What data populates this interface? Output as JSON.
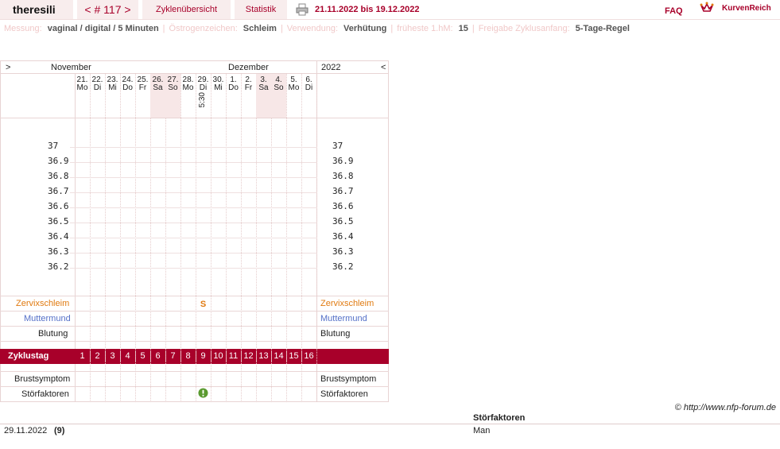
{
  "topbar": {
    "user": "theresili",
    "cycle_nav": "< # 117 >",
    "tab_overview": "Zyklenübersicht",
    "tab_stats": "Statistik",
    "date_range": "21.11.2022 bis 19.12.2022",
    "faq": "FAQ",
    "brand": "KurvenReich"
  },
  "info": [
    {
      "label": "Messung:",
      "value": "vaginal / digital / 5 Minuten"
    },
    {
      "label": "Östrogenzeichen:",
      "value": "Schleim"
    },
    {
      "label": "Verwendung:",
      "value": "Verhütung"
    },
    {
      "label": "früheste 1.hM:",
      "value": "15"
    },
    {
      "label": "Freigabe Zyklusanfang:",
      "value": "5-Tage-Regel"
    }
  ],
  "chart": {
    "nav_left": ">",
    "nav_right": "<",
    "month1": "November",
    "month2": "Dezember",
    "year": "2022",
    "days": [
      {
        "date": "21.",
        "wd": "Mo",
        "weekend": false
      },
      {
        "date": "22.",
        "wd": "Di",
        "weekend": false
      },
      {
        "date": "23.",
        "wd": "Mi",
        "weekend": false
      },
      {
        "date": "24.",
        "wd": "Do",
        "weekend": false
      },
      {
        "date": "25.",
        "wd": "Fr",
        "weekend": false
      },
      {
        "date": "26.",
        "wd": "Sa",
        "weekend": true
      },
      {
        "date": "27.",
        "wd": "So",
        "weekend": true
      },
      {
        "date": "28.",
        "wd": "Mo",
        "weekend": false
      },
      {
        "date": "29.",
        "wd": "Di",
        "weekend": false
      },
      {
        "date": "30.",
        "wd": "Mi",
        "weekend": false
      },
      {
        "date": "1.",
        "wd": "Do",
        "weekend": false
      },
      {
        "date": "2.",
        "wd": "Fr",
        "weekend": false
      },
      {
        "date": "3.",
        "wd": "Sa",
        "weekend": true
      },
      {
        "date": "4.",
        "wd": "So",
        "weekend": true
      },
      {
        "date": "5.",
        "wd": "Mo",
        "weekend": false
      },
      {
        "date": "6.",
        "wd": "Di",
        "weekend": false
      }
    ],
    "time_mark": {
      "day_index": 8,
      "text": "5:30"
    },
    "temps": [
      "37",
      "36.9",
      "36.8",
      "36.7",
      "36.6",
      "36.5",
      "36.4",
      "36.3",
      "36.2"
    ],
    "rows": {
      "zervix": "Zervixschleim",
      "muttermund": "Muttermund",
      "blutung": "Blutung",
      "zyklustag": "Zyklustag",
      "brust": "Brustsymptom",
      "stoer": "Störfaktoren"
    },
    "zervix_mark": {
      "day_index": 8,
      "text": "S"
    },
    "stoer_mark_day_index": 8,
    "cycle_days": [
      "1",
      "2",
      "3",
      "4",
      "5",
      "6",
      "7",
      "8",
      "9",
      "10",
      "11",
      "12",
      "13",
      "14",
      "15",
      "16"
    ]
  },
  "colors": {
    "accent": "#a8002a",
    "zervix": "#e07a10",
    "muttermund": "#5570c8",
    "stoer_icon": "#5a9a30"
  },
  "footer": {
    "copyright": "© http://www.nfp-forum.de",
    "notes_header": "Störfaktoren",
    "note_date": "29.11.2022",
    "note_num": "(9)",
    "note_value": "Man"
  }
}
